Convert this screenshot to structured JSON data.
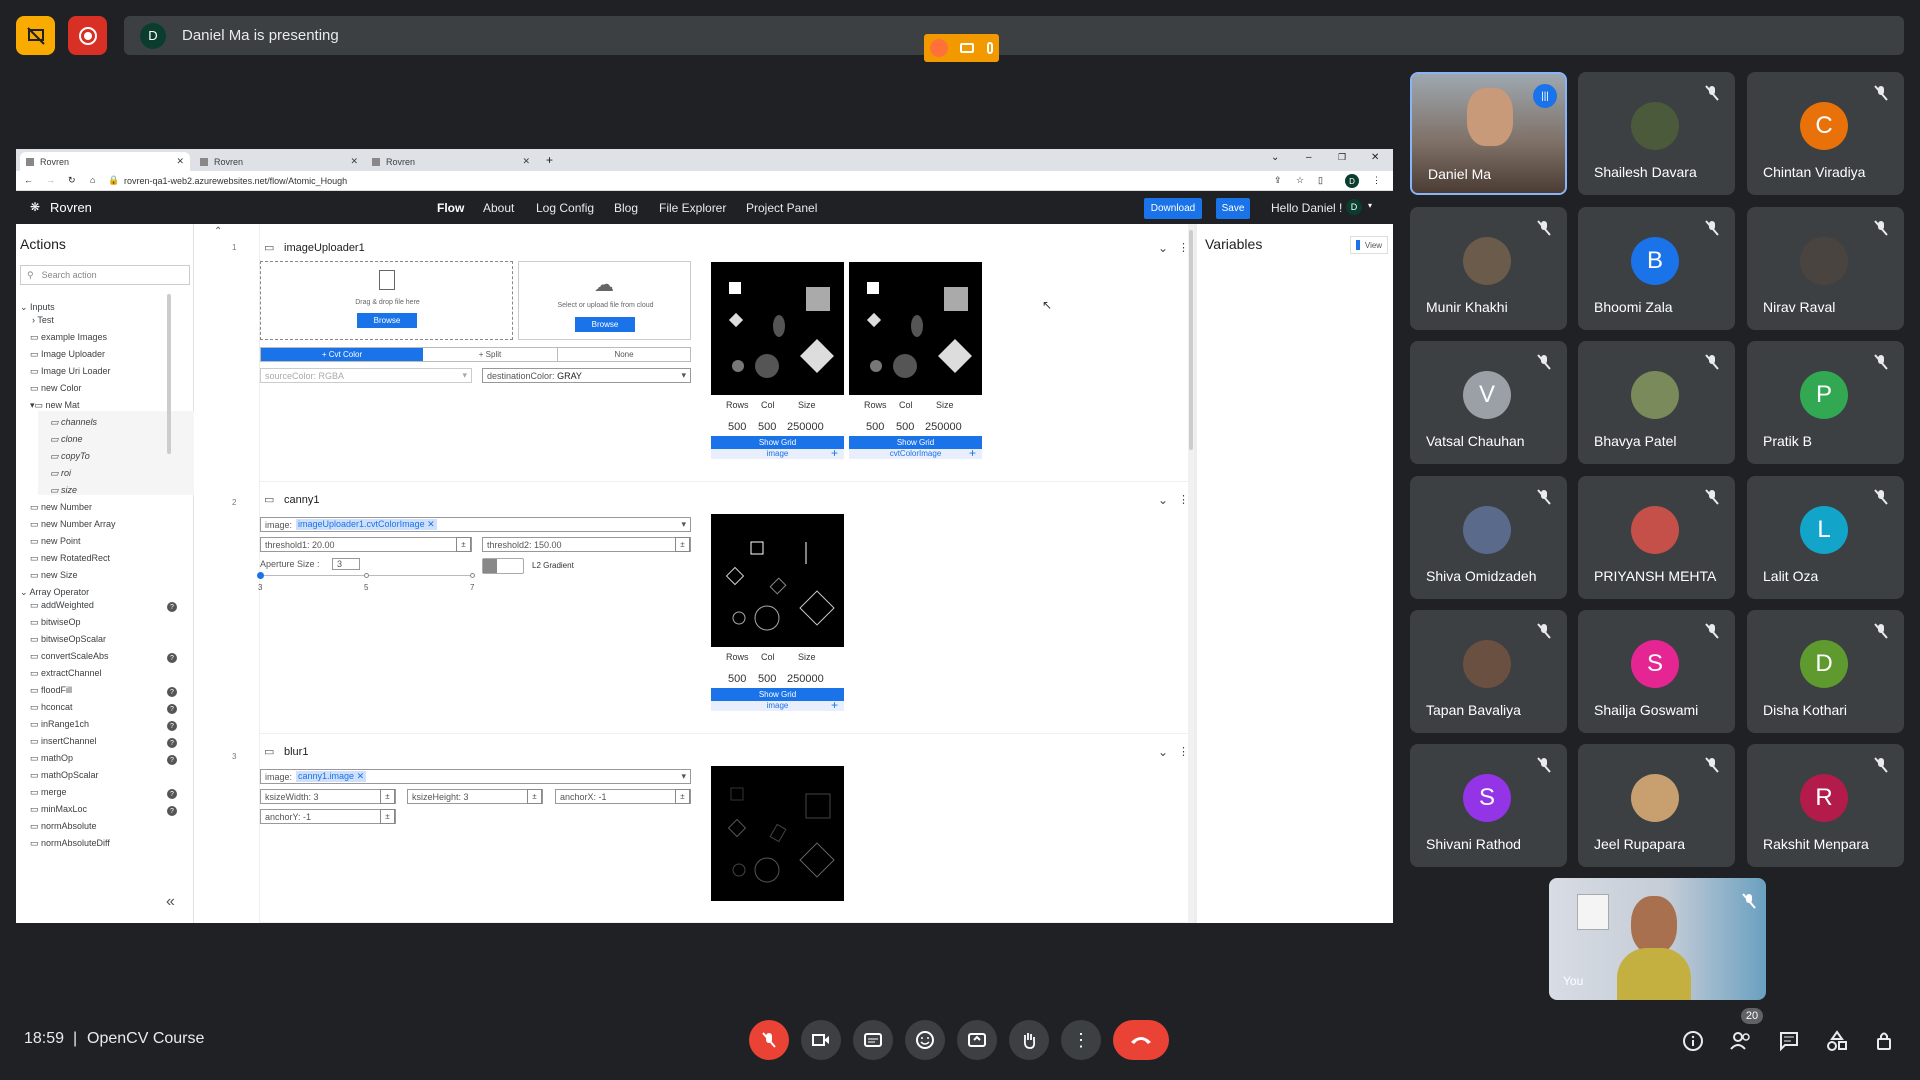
{
  "meeting": {
    "presenter_initial": "D",
    "presenting_text": "Daniel Ma is presenting",
    "time": "18:59",
    "separator": "|",
    "title": "OpenCV Course",
    "participant_count": "20"
  },
  "browser": {
    "tabs": [
      "Rovren",
      "Rovren",
      "Rovren"
    ],
    "url": "rovren-qa1-web2.azurewebsites.net/flow/Atomic_Hough",
    "profile_initial": "D"
  },
  "app": {
    "brand": "Rovren",
    "nav": [
      "Flow",
      "About",
      "Log Config",
      "Blog",
      "File Explorer",
      "Project Panel"
    ],
    "download_label": "Download",
    "save_label": "Save",
    "greeting": "Hello Daniel !",
    "user_initial": "D"
  },
  "actions": {
    "title": "Actions",
    "search_placeholder": "Search action",
    "inputs_group": "Inputs",
    "inputs": [
      "Test",
      "example Images",
      "Image Uploader",
      "Image Uri Loader",
      "new Color",
      "new Mat"
    ],
    "mat_children": [
      "channels",
      "clone",
      "copyTo",
      "roi",
      "size"
    ],
    "inputs2": [
      "new Number",
      "new Number Array",
      "new Point",
      "new RotatedRect",
      "new Size"
    ],
    "array_group": "Array Operator",
    "array_ops": [
      "addWeighted",
      "bitwiseOp",
      "bitwiseOpScalar",
      "convertScaleAbs",
      "extractChannel",
      "floodFill",
      "hconcat",
      "inRange1ch",
      "insertChannel",
      "mathOp",
      "mathOpScalar",
      "merge",
      "minMaxLoc",
      "normAbsolute",
      "normAbsoluteDiff"
    ],
    "badge_text": "?"
  },
  "nodes": {
    "n1": {
      "line": "1",
      "title": "imageUploader1",
      "drop_text": "Drag & drop file here",
      "cloud_text": "Select or upload file from cloud",
      "browse": "Browse",
      "tabs": [
        "+ Cvt Color",
        "+ Split",
        "None"
      ],
      "source": "sourceColor: RGBA",
      "dest_label": "destinationColor:",
      "dest_value": "GRAY",
      "img1_label": "image",
      "img2_label": "cvtColorImage"
    },
    "n2": {
      "line": "2",
      "title": "canny1",
      "image_label": "image:",
      "image_chip": "imageUploader1.cvtColorImage",
      "t1": "threshold1: 20.00",
      "t2": "threshold2: 150.00",
      "aperture_label": "Aperture Size :",
      "aperture_value": "3",
      "l2": "L2 Gradient",
      "ticks": [
        "3",
        "5",
        "7"
      ],
      "img_label": "image"
    },
    "n3": {
      "line": "3",
      "title": "blur1",
      "image_label": "image:",
      "image_chip": "canny1.image",
      "kw": "ksizeWidth: 3",
      "kh": "ksizeHeight: 3",
      "ax": "anchorX: -1",
      "ay": "anchorY: -1"
    },
    "info": {
      "rows": "Rows",
      "col": "Col",
      "size": "Size",
      "rows_v": "500",
      "col_v": "500",
      "size_v": "250000",
      "show_grid": "Show Grid"
    }
  },
  "variables": {
    "title": "Variables",
    "view_label": "View"
  },
  "participants": [
    {
      "name": "Daniel Ma",
      "initial": "",
      "color": "#5f6368"
    },
    {
      "name": "Shailesh Davara",
      "initial": "",
      "color": "#4a5a3a"
    },
    {
      "name": "Chintan Viradiya",
      "initial": "C",
      "color": "#e8710a"
    },
    {
      "name": "Munir Khakhi",
      "initial": "",
      "color": "#6b5b4a"
    },
    {
      "name": "Bhoomi Zala",
      "initial": "B",
      "color": "#1a73e8"
    },
    {
      "name": "Nirav Raval",
      "initial": "",
      "color": "#4a4440"
    },
    {
      "name": "Vatsal Chauhan",
      "initial": "V",
      "color": "#9aa0a6"
    },
    {
      "name": "Bhavya Patel",
      "initial": "",
      "color": "#7a8a5a"
    },
    {
      "name": "Pratik B",
      "initial": "P",
      "color": "#33a852"
    },
    {
      "name": "Shiva Omidzadeh",
      "initial": "",
      "color": "#5a6a8a"
    },
    {
      "name": "PRIYANSH MEHTA",
      "initial": "",
      "color": "#c5504a"
    },
    {
      "name": "Lalit Oza",
      "initial": "L",
      "color": "#12a4c9"
    },
    {
      "name": "Tapan Bavaliya",
      "initial": "",
      "color": "#6a5040"
    },
    {
      "name": "Shailja Goswami",
      "initial": "S",
      "color": "#e52592"
    },
    {
      "name": "Disha Kothari",
      "initial": "D",
      "color": "#5f9a2e"
    },
    {
      "name": "Shivani Rathod",
      "initial": "S",
      "color": "#9334e6"
    },
    {
      "name": "Jeel Rupapara",
      "initial": "",
      "color": "#c8a070"
    },
    {
      "name": "Rakshit Menpara",
      "initial": "R",
      "color": "#b31b4a"
    }
  ],
  "self_tile": {
    "label": "You"
  }
}
